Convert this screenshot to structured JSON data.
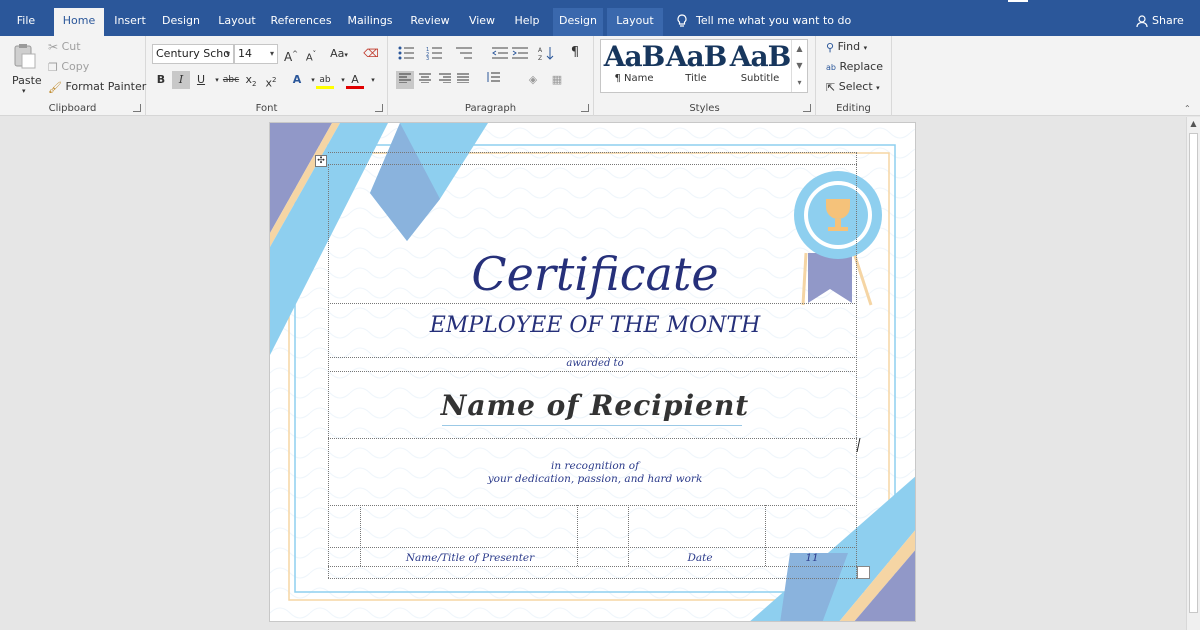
{
  "tabs": [
    {
      "label": "File",
      "active": false
    },
    {
      "label": "Home",
      "active": true
    },
    {
      "label": "Insert",
      "active": false
    },
    {
      "label": "Design",
      "active": false
    },
    {
      "label": "Layout",
      "active": false
    },
    {
      "label": "References",
      "active": false
    },
    {
      "label": "Mailings",
      "active": false
    },
    {
      "label": "Review",
      "active": false
    },
    {
      "label": "View",
      "active": false
    },
    {
      "label": "Help",
      "active": false
    },
    {
      "label": "Design",
      "active": false,
      "contextual": true
    },
    {
      "label": "Layout",
      "active": false,
      "contextual": true
    }
  ],
  "tell_me": "Tell me what you want to do",
  "share": "Share",
  "clipboard": {
    "paste": "Paste",
    "cut": "Cut",
    "copy": "Copy",
    "format_painter": "Format Painter",
    "label": "Clipboard"
  },
  "font": {
    "name": "Century Scho",
    "size": "14",
    "grow": "A",
    "shrink": "A",
    "case": "Aa",
    "bold": "B",
    "italic": "I",
    "underline": "U",
    "strike": "abc",
    "subscript": "x",
    "superscript": "x",
    "effects": "A",
    "highlight": "ab",
    "color": "A",
    "label": "Font"
  },
  "paragraph": {
    "label": "Paragraph",
    "pilcrow": "¶"
  },
  "styles": {
    "label": "Styles",
    "items": [
      {
        "preview": "AaB",
        "name": "¶ Name"
      },
      {
        "preview": "AaB",
        "name": "Title"
      },
      {
        "preview": "AaB",
        "name": "Subtitle"
      }
    ]
  },
  "editing": {
    "label": "Editing",
    "find": "Find",
    "replace": "Replace",
    "select": "Select"
  },
  "certificate": {
    "title": "Certificate",
    "subtitle": "EMPLOYEE OF THE MONTH",
    "awarded_to": "awarded to",
    "recipient": "Name of Recipient",
    "recognition_line1": "in recognition of",
    "recognition_line2": "your dedication, passion, and hard work",
    "presenter": "Name/Title of Presenter",
    "date": "Date",
    "number": "11"
  },
  "colors": {
    "ribbon_blue": "#2b579a",
    "cert_navy": "#26307a",
    "light_blue": "#8ecfef",
    "mid_blue": "#8ab3dd",
    "lavender": "#9198c8",
    "peach": "#f5d5a4"
  }
}
